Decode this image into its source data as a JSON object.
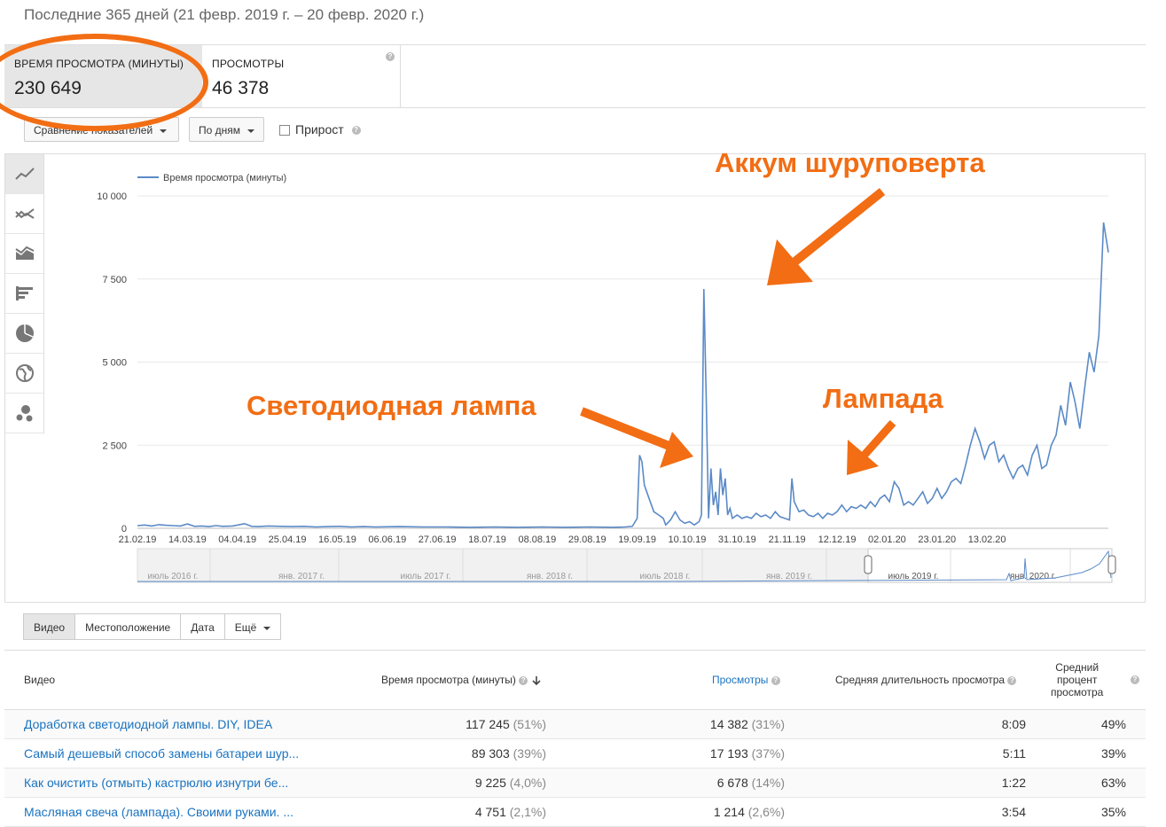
{
  "header": {
    "date_range": "Последние 365 дней (21 февр. 2019 г. – 20 февр. 2020 г.)"
  },
  "metrics": [
    {
      "label": "ВРЕМЯ ПРОСМОТРА (МИНУТЫ)",
      "value": "230 649"
    },
    {
      "label": "ПРОСМОТРЫ",
      "value": "46 378"
    }
  ],
  "controls": {
    "compare_label": "Сравнение показателей",
    "interval_label": "По дням",
    "growth_label": "Прирост"
  },
  "chart_data": {
    "type": "line",
    "legend": "Время просмотра (минуты)",
    "y_ticks": [
      "10 000",
      "7 500",
      "5 000",
      "2 500",
      "0"
    ],
    "ylim": [
      0,
      10000
    ],
    "x_ticks": [
      "21.02.19",
      "14.03.19",
      "04.04.19",
      "25.04.19",
      "16.05.19",
      "06.06.19",
      "27.06.19",
      "18.07.19",
      "08.08.19",
      "29.08.19",
      "19.09.19",
      "10.10.19",
      "31.10.19",
      "21.11.19",
      "12.12.19",
      "02.01.20",
      "23.01.20",
      "13.02.20"
    ],
    "series": [
      {
        "points": [
          [
            0,
            80
          ],
          [
            3,
            100
          ],
          [
            6,
            70
          ],
          [
            9,
            110
          ],
          [
            12,
            90
          ],
          [
            15,
            80
          ],
          [
            18,
            70
          ],
          [
            21,
            130
          ],
          [
            24,
            60
          ],
          [
            27,
            70
          ],
          [
            30,
            50
          ],
          [
            33,
            80
          ],
          [
            36,
            60
          ],
          [
            40,
            70
          ],
          [
            45,
            140
          ],
          [
            48,
            60
          ],
          [
            51,
            50
          ],
          [
            55,
            70
          ],
          [
            60,
            60
          ],
          [
            65,
            50
          ],
          [
            70,
            60
          ],
          [
            75,
            40
          ],
          [
            80,
            50
          ],
          [
            85,
            60
          ],
          [
            90,
            40
          ],
          [
            95,
            50
          ],
          [
            100,
            40
          ],
          [
            110,
            50
          ],
          [
            120,
            40
          ],
          [
            130,
            40
          ],
          [
            140,
            30
          ],
          [
            150,
            40
          ],
          [
            160,
            30
          ],
          [
            170,
            40
          ],
          [
            180,
            30
          ],
          [
            190,
            40
          ],
          [
            200,
            30
          ],
          [
            205,
            40
          ],
          [
            208,
            60
          ],
          [
            210,
            300
          ],
          [
            211,
            2200
          ],
          [
            212,
            2000
          ],
          [
            213,
            1300
          ],
          [
            215,
            900
          ],
          [
            217,
            500
          ],
          [
            219,
            400
          ],
          [
            221,
            300
          ],
          [
            222,
            100
          ],
          [
            224,
            250
          ],
          [
            226,
            500
          ],
          [
            228,
            250
          ],
          [
            230,
            150
          ],
          [
            232,
            200
          ],
          [
            234,
            100
          ],
          [
            236,
            200
          ],
          [
            237,
            400
          ],
          [
            238,
            7200
          ],
          [
            239,
            4000
          ],
          [
            240,
            300
          ],
          [
            241,
            1800
          ],
          [
            242,
            700
          ],
          [
            243,
            1100
          ],
          [
            244,
            400
          ],
          [
            245,
            1800
          ],
          [
            246,
            1000
          ],
          [
            247,
            1500
          ],
          [
            248,
            400
          ],
          [
            249,
            600
          ],
          [
            250,
            300
          ],
          [
            252,
            400
          ],
          [
            254,
            300
          ],
          [
            256,
            350
          ],
          [
            258,
            300
          ],
          [
            260,
            450
          ],
          [
            262,
            350
          ],
          [
            264,
            400
          ],
          [
            266,
            300
          ],
          [
            268,
            500
          ],
          [
            270,
            350
          ],
          [
            272,
            300
          ],
          [
            274,
            250
          ],
          [
            275,
            1500
          ],
          [
            276,
            800
          ],
          [
            278,
            500
          ],
          [
            280,
            550
          ],
          [
            282,
            400
          ],
          [
            284,
            350
          ],
          [
            286,
            450
          ],
          [
            288,
            300
          ],
          [
            290,
            450
          ],
          [
            292,
            400
          ],
          [
            294,
            500
          ],
          [
            296,
            700
          ],
          [
            298,
            500
          ],
          [
            300,
            650
          ],
          [
            302,
            600
          ],
          [
            304,
            700
          ],
          [
            306,
            600
          ],
          [
            308,
            800
          ],
          [
            310,
            650
          ],
          [
            312,
            900
          ],
          [
            314,
            1000
          ],
          [
            316,
            800
          ],
          [
            318,
            1400
          ],
          [
            320,
            1200
          ],
          [
            322,
            700
          ],
          [
            324,
            800
          ],
          [
            326,
            700
          ],
          [
            328,
            900
          ],
          [
            330,
            1100
          ],
          [
            332,
            750
          ],
          [
            334,
            900
          ],
          [
            336,
            1200
          ],
          [
            338,
            900
          ],
          [
            340,
            1100
          ],
          [
            342,
            1400
          ],
          [
            344,
            1500
          ],
          [
            346,
            1350
          ],
          [
            348,
            1900
          ],
          [
            350,
            2500
          ],
          [
            352,
            3000
          ],
          [
            354,
            2600
          ],
          [
            356,
            2100
          ],
          [
            358,
            2500
          ],
          [
            360,
            2600
          ],
          [
            362,
            2000
          ],
          [
            364,
            2200
          ],
          [
            366,
            1800
          ],
          [
            368,
            1500
          ],
          [
            370,
            1800
          ],
          [
            372,
            1900
          ],
          [
            374,
            1600
          ],
          [
            376,
            2200
          ],
          [
            378,
            2500
          ],
          [
            380,
            1800
          ],
          [
            382,
            1900
          ],
          [
            384,
            2500
          ],
          [
            386,
            2800
          ],
          [
            388,
            3700
          ],
          [
            390,
            3100
          ],
          [
            392,
            4400
          ],
          [
            394,
            3800
          ],
          [
            396,
            3000
          ],
          [
            398,
            4200
          ],
          [
            400,
            5300
          ],
          [
            402,
            4700
          ],
          [
            404,
            5800
          ],
          [
            406,
            9200
          ],
          [
            408,
            8300
          ]
        ]
      }
    ],
    "x_domain": [
      0,
      408
    ],
    "navigator_ticks": [
      "июль 2016 г.",
      "янв. 2017 г.",
      "июль 2017 г.",
      "янв. 2018 г.",
      "июль 2018 г.",
      "янв. 2019 г.",
      "июль 2019 г.",
      "янв. 2020 г."
    ]
  },
  "annotations": {
    "a1": "Аккум шуруповерта",
    "a2": "Светодиодная лампа",
    "a3": "Лампада"
  },
  "tabs": [
    "Видео",
    "Местоположение",
    "Дата",
    "Ещё"
  ],
  "table": {
    "headers": {
      "video": "Видео",
      "watch_time": "Время просмотра (минуты)",
      "views": "Просмотры",
      "avg_duration": "Средняя длительность просмотра",
      "avg_pct_1": "Средний",
      "avg_pct_2": "процент",
      "avg_pct_3": "просмотра"
    },
    "rows": [
      {
        "title": "Доработка светодиодной лампы. DIY, IDEA",
        "watch": "117 245",
        "watch_pct": "(51%)",
        "views": "14 382",
        "views_pct": "(31%)",
        "dur": "8:09",
        "pct": "49%"
      },
      {
        "title": "Самый дешевый способ замены батареи шур...",
        "watch": "89 303",
        "watch_pct": "(39%)",
        "views": "17 193",
        "views_pct": "(37%)",
        "dur": "5:11",
        "pct": "39%"
      },
      {
        "title": "Как очистить (отмыть) кастрюлю изнутри бе...",
        "watch": "9 225",
        "watch_pct": "(4,0%)",
        "views": "6 678",
        "views_pct": "(14%)",
        "dur": "1:22",
        "pct": "63%"
      },
      {
        "title": "Масляная свеча (лампада). Своими руками. ...",
        "watch": "4 751",
        "watch_pct": "(2,1%)",
        "views": "1 214",
        "views_pct": "(2,6%)",
        "dur": "3:54",
        "pct": "35%"
      }
    ]
  },
  "colors": {
    "accent": "#f26d13",
    "series": "#5b8ac7",
    "link": "#1a73c0"
  }
}
